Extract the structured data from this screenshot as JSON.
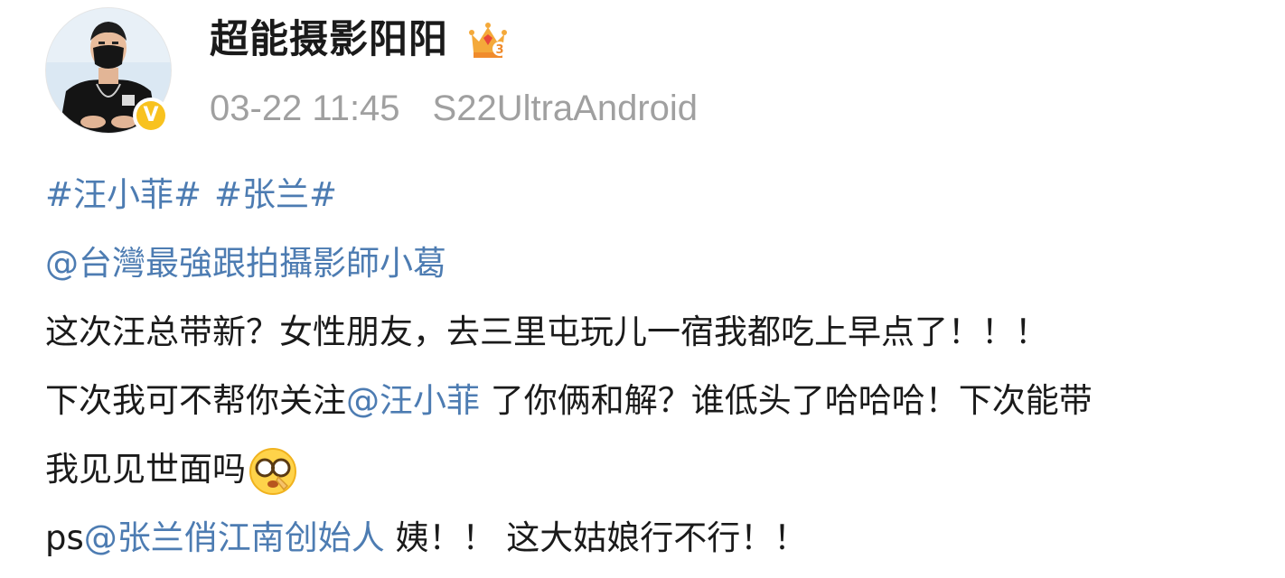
{
  "post": {
    "author": {
      "name": "超能摄影阳阳",
      "avatar_icon": "user-avatar",
      "verified_icon": "verified-v-badge",
      "verified_glyph": "V",
      "vip_icon": "vip-crown-level-3-icon"
    },
    "time": "03-22 11:45",
    "source": "S22UltraAndroid",
    "hashtags": [
      "#汪小菲#",
      "#张兰#"
    ],
    "mention_line": "@台灣最強跟拍攝影師小葛",
    "line3": "这次汪总带新？女性朋友，去三里屯玩儿一宿我都吃上早点了！！！",
    "line4_before": "下次我可不帮你关注",
    "line4_mention": "@汪小菲",
    "line4_after": " 了你俩和解？谁低头了哈哈哈！下次能带",
    "line5": "我见见世面吗",
    "line5_emoji": "dazzled-glasses-emoji",
    "line6_before": "ps",
    "line6_mention": "@张兰俏江南创始人",
    "line6_after": " 姨！！ 这大姑娘行不行！！"
  },
  "colors": {
    "link": "#4d7cb2",
    "meta": "#a0a0a0",
    "text": "#1a1a1a",
    "verified": "#f8c21f"
  }
}
